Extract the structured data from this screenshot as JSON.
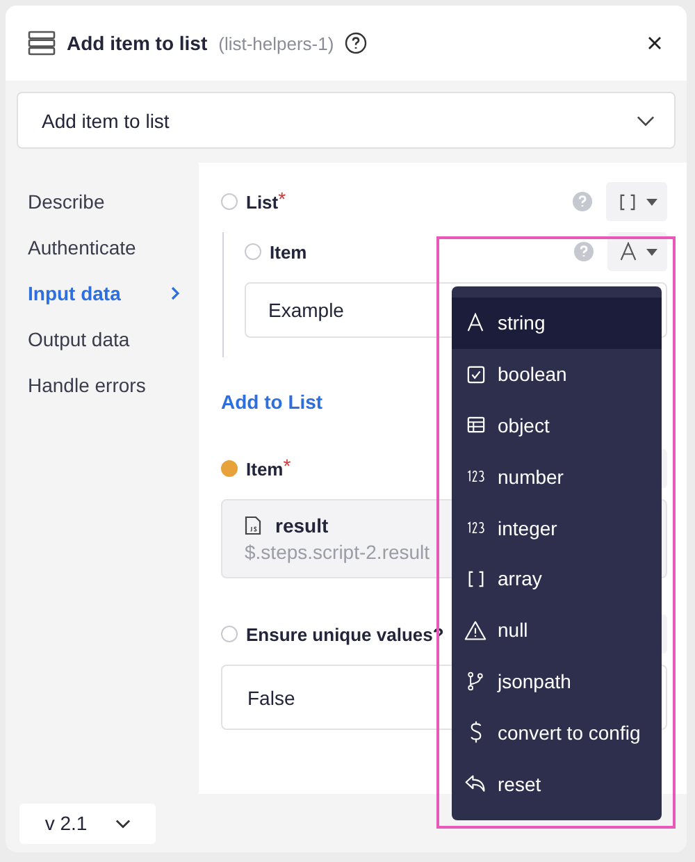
{
  "window": {
    "title": "Add item to list",
    "subtitle": "(list-helpers-1)"
  },
  "action_select": {
    "value": "Add item to list"
  },
  "sidebar": {
    "items": [
      {
        "label": "Describe",
        "selected": false
      },
      {
        "label": "Authenticate",
        "selected": false
      },
      {
        "label": "Input data",
        "selected": true
      },
      {
        "label": "Output data",
        "selected": false
      },
      {
        "label": "Handle errors",
        "selected": false
      }
    ]
  },
  "fields": [
    {
      "kind": "list",
      "label": "List",
      "required_mark": "*",
      "filled": false,
      "children": [
        {
          "label": "Item",
          "filled": false,
          "value": "Example"
        }
      ],
      "add_link": "Add to List"
    },
    {
      "kind": "reference",
      "label": "Item",
      "required_mark": "*",
      "filled": true,
      "ref_name": "result",
      "ref_path": "$.steps.script-2.result"
    },
    {
      "kind": "select",
      "label": "Ensure unique values?",
      "filled": false,
      "value": "False"
    }
  ],
  "type_menu": {
    "items": [
      {
        "label": "string",
        "selected": true
      },
      {
        "label": "boolean",
        "selected": false
      },
      {
        "label": "object",
        "selected": false
      },
      {
        "label": "number",
        "selected": false
      },
      {
        "label": "integer",
        "selected": false
      },
      {
        "label": "array",
        "selected": false
      },
      {
        "label": "null",
        "selected": false
      },
      {
        "label": "jsonpath",
        "selected": false
      },
      {
        "label": "convert to config",
        "selected": false
      },
      {
        "label": "reset",
        "selected": false
      }
    ]
  },
  "version": {
    "value": "v 2.1"
  }
}
